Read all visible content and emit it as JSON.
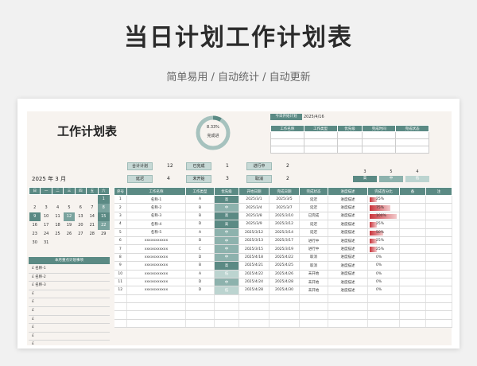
{
  "hero": {
    "title": "当日计划工作计划表",
    "subtitle": "简单易用  /  自动统计  /  自动更新"
  },
  "sheet": {
    "title": "工作计划表",
    "donut": {
      "percent_label": "8.33%",
      "label": "完成进",
      "fraction": 0.0833,
      "ring_color": "#a6c2be",
      "fill_color": "#5b8a84"
    },
    "plan_date_label": "今日开始计划",
    "plan_date_value": "2025/4/16",
    "mini_table_headers": [
      "工作名称",
      "工作类型",
      "优先级",
      "完成时间",
      "完成状态"
    ],
    "stats": [
      {
        "label": "合计计划",
        "value": "12"
      },
      {
        "label": "已完成",
        "value": "1"
      },
      {
        "label": "进行中",
        "value": "2"
      },
      {
        "label": "延迟",
        "value": "4"
      },
      {
        "label": "未开始",
        "value": "3"
      },
      {
        "label": "取消",
        "value": "2"
      }
    ],
    "month": {
      "year": "2025",
      "year_unit": "年",
      "month": "3",
      "month_unit": "月"
    },
    "priority_counts": [
      {
        "count": "3",
        "label": "高",
        "color": "#5b8a84"
      },
      {
        "count": "5",
        "label": "中",
        "color": "#8db2ad"
      },
      {
        "count": "4",
        "label": "低",
        "color": "#bcd4d0"
      }
    ],
    "calendar": {
      "weekdays": [
        "日",
        "一",
        "二",
        "三",
        "四",
        "五",
        "六"
      ],
      "rows": [
        [
          "",
          "",
          "",
          "",
          "",
          "",
          "1"
        ],
        [
          "2",
          "3",
          "4",
          "5",
          "6",
          "7",
          "8"
        ],
        [
          "9",
          "10",
          "11",
          "12",
          "13",
          "14",
          "15"
        ],
        [
          "16",
          "17",
          "18",
          "19",
          "20",
          "21",
          "22"
        ],
        [
          "23",
          "24",
          "25",
          "26",
          "27",
          "28",
          "29"
        ],
        [
          "30",
          "31",
          "",
          "",
          "",
          "",
          ""
        ]
      ]
    },
    "focus_panel": {
      "title": "本月重点计划事项",
      "items": [
        "£  名称-1",
        "£  名称-2",
        "£  名称-3",
        "£",
        "£",
        "£",
        "£",
        "£",
        "£",
        "£",
        "£"
      ]
    },
    "main_table": {
      "headers": [
        "序号",
        "工作名称",
        "工作类型",
        "优先级",
        "开始日期",
        "完成日期",
        "完成状态",
        "进度描述",
        "完成百分比",
        "备",
        "注"
      ],
      "rows": [
        {
          "no": "1",
          "name": "名称-1",
          "type": "A",
          "prio": "高",
          "start": "2025/3/1",
          "end": "2025/3/5",
          "status": "延迟",
          "desc": "进度描述",
          "pct": "25%",
          "frac": 0.25
        },
        {
          "no": "2",
          "name": "名称-2",
          "type": "B",
          "prio": "中",
          "start": "2025/3/4",
          "end": "2025/3/7",
          "status": "延迟",
          "desc": "进度描述",
          "pct": "75%",
          "frac": 0.75
        },
        {
          "no": "3",
          "name": "名称-3",
          "type": "B",
          "prio": "高",
          "start": "2025/3/8",
          "end": "2025/3/10",
          "status": "已完成",
          "desc": "进度描述",
          "pct": "100%",
          "frac": 1.0
        },
        {
          "no": "4",
          "name": "名称-4",
          "type": "D",
          "prio": "高",
          "start": "2025/3/9",
          "end": "2025/3/12",
          "status": "延迟",
          "desc": "进度描述",
          "pct": "25%",
          "frac": 0.25
        },
        {
          "no": "5",
          "name": "名称-5",
          "type": "A",
          "prio": "中",
          "start": "2025/3/12",
          "end": "2025/3/14",
          "status": "延迟",
          "desc": "进度描述",
          "pct": "50%",
          "frac": 0.5
        },
        {
          "no": "6",
          "name": "xxxxxxxxxxx",
          "type": "B",
          "prio": "中",
          "start": "2025/3/13",
          "end": "2025/3/17",
          "status": "进行中",
          "desc": "进度描述",
          "pct": "25%",
          "frac": 0.25
        },
        {
          "no": "7",
          "name": "xxxxxxxxxxx",
          "type": "C",
          "prio": "中",
          "start": "2025/3/15",
          "end": "2025/3/19",
          "status": "进行中",
          "desc": "进度描述",
          "pct": "25%",
          "frac": 0.25
        },
        {
          "no": "8",
          "name": "xxxxxxxxxxx",
          "type": "D",
          "prio": "中",
          "start": "2025/4/18",
          "end": "2025/4/22",
          "status": "取消",
          "desc": "进度描述",
          "pct": "0%",
          "frac": 0
        },
        {
          "no": "9",
          "name": "xxxxxxxxxxx",
          "type": "B",
          "prio": "高",
          "start": "2025/4/21",
          "end": "2025/4/25",
          "status": "取消",
          "desc": "进度描述",
          "pct": "0%",
          "frac": 0
        },
        {
          "no": "10",
          "name": "xxxxxxxxxxx",
          "type": "A",
          "prio": "低",
          "start": "2025/4/22",
          "end": "2025/4/26",
          "status": "未开始",
          "desc": "进度描述",
          "pct": "0%",
          "frac": 0
        },
        {
          "no": "11",
          "name": "xxxxxxxxxxx",
          "type": "D",
          "prio": "中",
          "start": "2025/4/24",
          "end": "2025/4/28",
          "status": "未开始",
          "desc": "进度描述",
          "pct": "0%",
          "frac": 0
        },
        {
          "no": "12",
          "name": "xxxxxxxxxxx",
          "type": "D",
          "prio": "低",
          "start": "2025/4/28",
          "end": "2025/4/30",
          "status": "未开始",
          "desc": "进度描述",
          "pct": "0%",
          "frac": 0
        },
        {
          "no": "",
          "name": "",
          "type": "",
          "prio": "",
          "start": "",
          "end": "",
          "status": "",
          "desc": "",
          "pct": "",
          "frac": 0
        },
        {
          "no": "",
          "name": "",
          "type": "",
          "prio": "",
          "start": "",
          "end": "",
          "status": "",
          "desc": "",
          "pct": "",
          "frac": 0
        },
        {
          "no": "",
          "name": "",
          "type": "",
          "prio": "",
          "start": "",
          "end": "",
          "status": "",
          "desc": "",
          "pct": "",
          "frac": 0
        },
        {
          "no": "",
          "name": "",
          "type": "",
          "prio": "",
          "start": "",
          "end": "",
          "status": "",
          "desc": "",
          "pct": "",
          "frac": 0
        }
      ]
    }
  }
}
